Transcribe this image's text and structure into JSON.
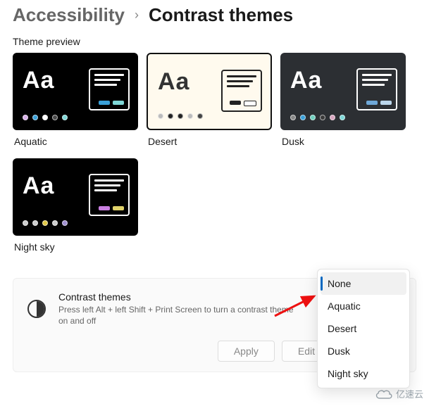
{
  "breadcrumb": {
    "root": "Accessibility",
    "leaf": "Contrast themes"
  },
  "section_label": "Theme preview",
  "themes": [
    {
      "name": "Aquatic",
      "class": "t-aquatic",
      "dots": [
        "#d7b0e8",
        "#3aa0d8",
        "#ffffff",
        "#4a4a4a",
        "#7fd7d7"
      ]
    },
    {
      "name": "Desert",
      "class": "t-desert",
      "dots": [
        "#bbbbbb",
        "#222222",
        "#222222",
        "#bbbbbb",
        "#444444"
      ]
    },
    {
      "name": "Dusk",
      "class": "t-dusk",
      "dots": [
        "#888888",
        "#3aa0d8",
        "#6fcfbf",
        "#3a3a3a",
        "#d8a6c0",
        "#7fd7d7"
      ]
    },
    {
      "name": "Night sky",
      "class": "t-night",
      "dots": [
        "#cccccc",
        "#cccccc",
        "#e0c846",
        "#cccccc",
        "#a090d0"
      ]
    }
  ],
  "panel": {
    "title": "Contrast themes",
    "subtitle": "Press left Alt + left Shift + Print Screen to turn a contrast theme on and off",
    "apply": "Apply",
    "edit": "Edit"
  },
  "dropdown": {
    "selected": "None",
    "items": [
      "None",
      "Aquatic",
      "Desert",
      "Dusk",
      "Night sky"
    ]
  },
  "watermark": "亿速云"
}
